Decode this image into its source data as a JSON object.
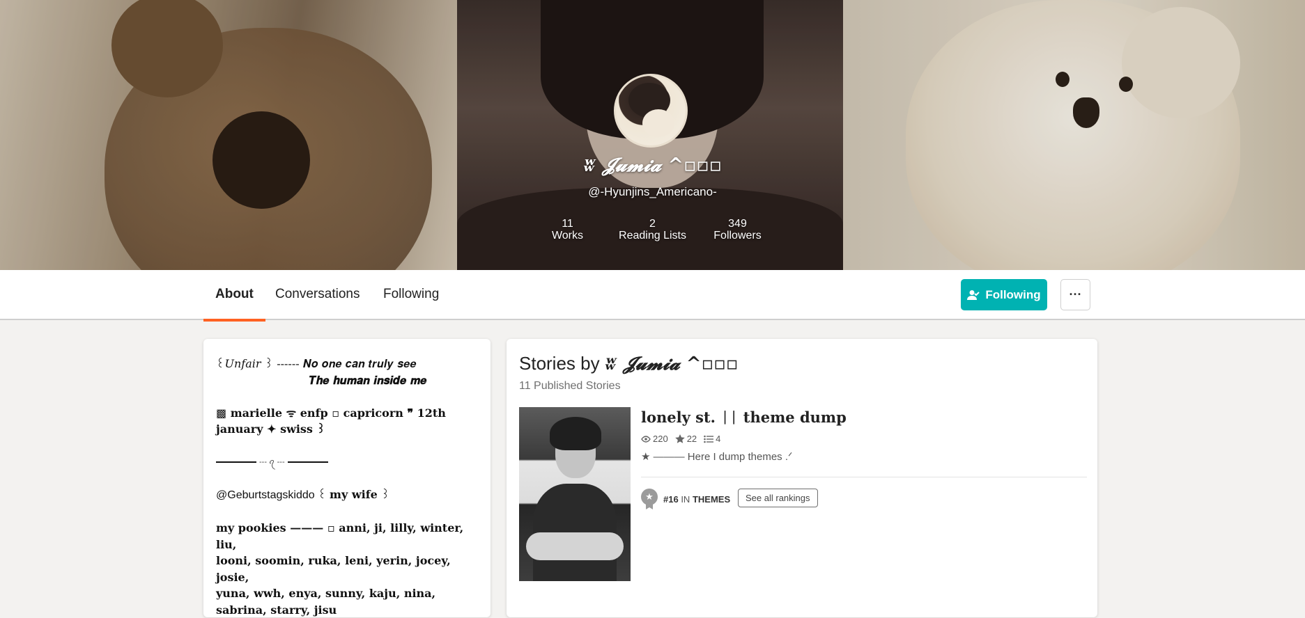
{
  "profile": {
    "name": "ʬ 𝓙𝓾𝓶𝓲𝓪 ^⁠▫⁠▫⁠▫",
    "handle": "@-Hyunjins_Americano-",
    "stats": [
      {
        "value": "11",
        "label": "Works"
      },
      {
        "value": "2",
        "label": "Reading Lists"
      },
      {
        "value": "349",
        "label": "Followers"
      }
    ]
  },
  "tabs": {
    "about": "About",
    "conversations": "Conversations",
    "following": "Following"
  },
  "actions": {
    "following_label": "Following",
    "more_label": "···"
  },
  "about": {
    "line1": "꒰𝑈𝑛𝑓𝑎𝑖𝑟 ꒱ ------ 𝑵𝒐 𝒐𝒏𝒆 𝒄𝒂𝒏 𝒕𝒓𝒖𝒍𝒚 𝒔𝒆𝒆",
    "line2": "𝑻𝒉𝒆 𝒉𝒖𝒎𝒂𝒏 𝒊𝒏𝒔𝒊𝒅𝒆 𝒎𝒆",
    "line3": "▩  marielle  ᯤ  enfp  ▫  capricorn  ❞  12th",
    "line4": "january  ✦  swiss  ꒱",
    "rule_mid": "--- ꪖ ---",
    "line5_a": "@Geburtstagskiddo ꒰ ",
    "line5_b": "my wife",
    "line5_c": " ꒱",
    "line6": "my pookies ——— ▫ anni,  ji,  lilly,  winter,  liu,",
    "line7": "looni,  soomin,   ruka,  leni,  yerin,  jocey,  josie,",
    "line8": "yuna,  wwh,  enya,   sunny,   kaju,   nina,",
    "line9": "sabrina,   starry,   jisu"
  },
  "stories": {
    "title_prefix": "Stories by ",
    "title_name": "ʬ 𝓙𝓾𝓶𝓲𝓪 ^⁠▫⁠▫⁠▫",
    "count": "11 Published Stories",
    "items": [
      {
        "title": "lonely st. ᛁᛁ theme dump",
        "reads": "220",
        "votes": "22",
        "parts": "4",
        "description": "★ ——— Here I dump themes .ᐟ",
        "rank_number": "#16",
        "rank_in": " IN ",
        "rank_category": "THEMES",
        "rank_button": "See all rankings"
      }
    ]
  },
  "icons": {
    "eye": "eye-icon",
    "star": "star-icon",
    "list": "list-icon",
    "follow": "user-check-icon",
    "medal": "medal-icon"
  },
  "colors": {
    "accent_teal": "#00b2b2",
    "tab_underline": "#ff6122"
  }
}
